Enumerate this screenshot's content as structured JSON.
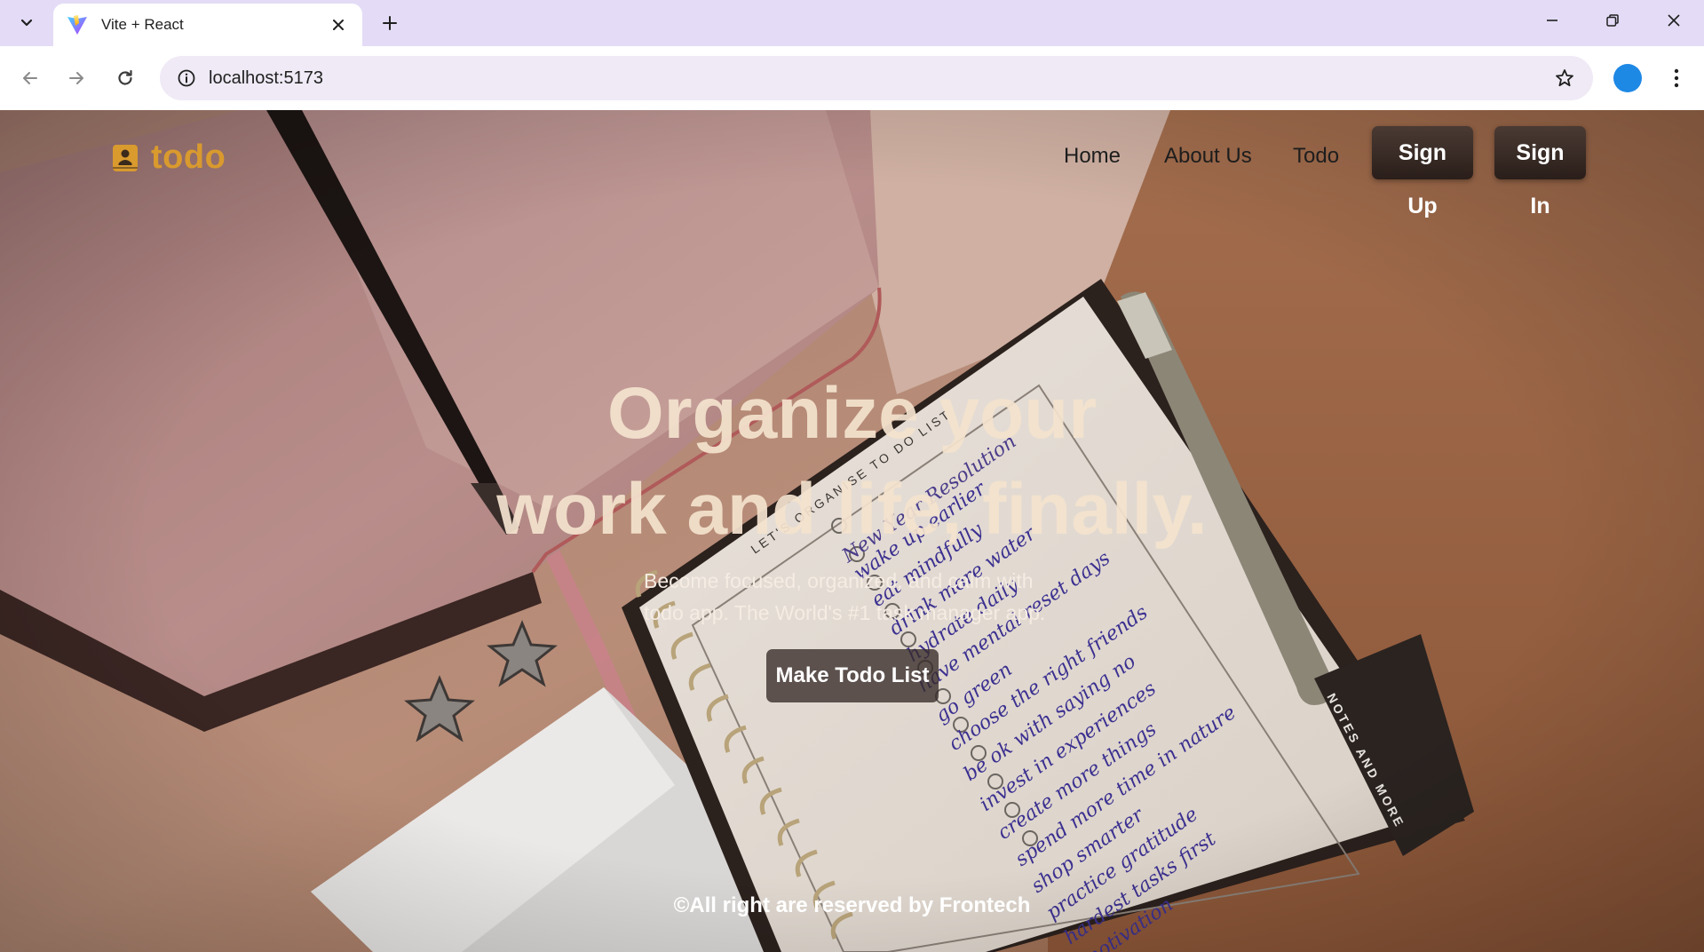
{
  "browser": {
    "tab_title": "Vite + React",
    "url": "localhost:5173",
    "icons": {
      "tab_search": "chevron-down-icon",
      "favicon": "vite-logo-icon",
      "close_tab": "close-icon",
      "new_tab": "plus-icon",
      "minimize": "minimize-icon",
      "restore": "restore-icon",
      "close_window": "close-icon",
      "back": "arrow-left-icon",
      "forward": "arrow-right-icon",
      "reload": "reload-icon",
      "site_info": "info-icon",
      "bookmark": "star-icon",
      "menu": "kebab-icon"
    }
  },
  "page": {
    "brand": {
      "name": "todo",
      "icon": "book-icon",
      "color": "#d99a2e"
    },
    "nav": {
      "links": [
        "Home",
        "About Us",
        "Todo"
      ],
      "signup_label": "Sign Up",
      "signin_label": "Sign In"
    },
    "hero": {
      "title_line1": "Organize your",
      "title_line2": "work and life, finally.",
      "subtitle_line1": "Become focused, organized, and calm with",
      "subtitle_line2": "todo app. The World's #1 task manager app.",
      "cta_label": "Make Todo List"
    },
    "footer": {
      "text": "©All right are reserved by Frontech"
    },
    "background": {
      "notebook_header": "LET'S ORGANISE TO DO LIST",
      "notebook_heading": "New Year Resolution",
      "notebook_items": [
        "wake up earlier",
        "eat mindfully",
        "drink more water",
        "hydrate daily",
        "have mental reset days",
        "go green",
        "choose the right friends",
        "be ok with saying no",
        "invest in experiences",
        "create more things",
        "spend more time in nature",
        "shop smarter",
        "practice gratitude",
        "hardest tasks first",
        "motivation"
      ],
      "tab_label": "NOTES AND MORE"
    }
  }
}
